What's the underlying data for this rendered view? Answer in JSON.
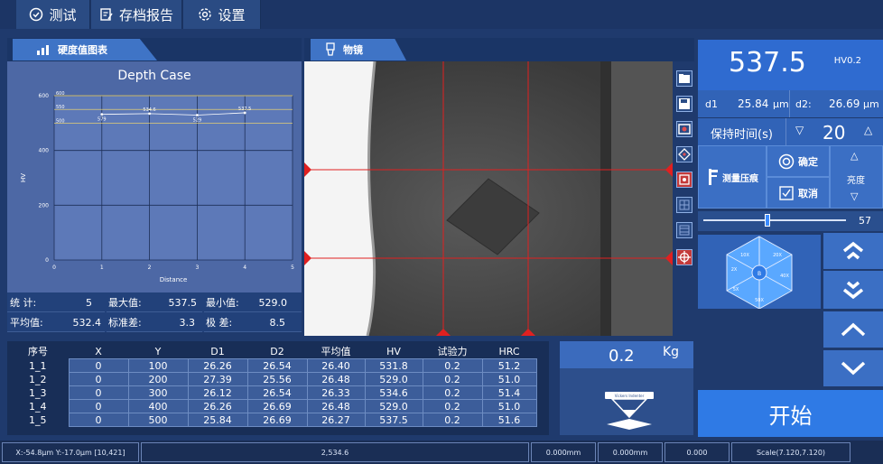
{
  "menu": {
    "test_label": "测试",
    "archive_label": "存档报告",
    "settings_label": "设置"
  },
  "tabs": {
    "chart_tab": "硬度值图表",
    "objective_tab": "物镜"
  },
  "chart_data": {
    "type": "line",
    "title": "Depth Case",
    "xlabel": "Distance",
    "ylabel": "HV",
    "x": [
      1,
      2,
      3,
      4
    ],
    "values": [
      531.8,
      534.6,
      529.0,
      537.5
    ],
    "point_labels": [
      "579",
      "534.6",
      "529",
      "537.5"
    ],
    "xlim": [
      0,
      5
    ],
    "ylim": [
      0,
      600
    ],
    "xticks": [
      "0",
      "1",
      "2",
      "3",
      "4",
      "5"
    ],
    "yticks": [
      "0",
      "200",
      "400",
      "600"
    ],
    "ref_lines": [
      {
        "label": "600",
        "value": 600
      },
      {
        "label": "550",
        "value": 550
      },
      {
        "label": "500",
        "value": 500
      }
    ],
    "grid": true
  },
  "stats": {
    "count_label": "统 计:",
    "count": "5",
    "max_label": "最大值:",
    "max": "537.5",
    "min_label": "最小值:",
    "min": "529.0",
    "avg_label": "平均值:",
    "avg": "532.4",
    "std_label": "标准差:",
    "std": "3.3",
    "range_label": "极 差:",
    "range": "8.5"
  },
  "table": {
    "headers": [
      "序号",
      "X",
      "Y",
      "D1",
      "D2",
      "平均值",
      "HV",
      "试验力",
      "HRC"
    ],
    "rows": [
      [
        "1_1",
        "0",
        "100",
        "26.26",
        "26.54",
        "26.40",
        "531.8",
        "0.2",
        "51.2"
      ],
      [
        "1_2",
        "0",
        "200",
        "27.39",
        "25.56",
        "26.48",
        "529.0",
        "0.2",
        "51.0"
      ],
      [
        "1_3",
        "0",
        "300",
        "26.12",
        "26.54",
        "26.33",
        "534.6",
        "0.2",
        "51.4"
      ],
      [
        "1_4",
        "0",
        "400",
        "26.26",
        "26.69",
        "26.48",
        "529.0",
        "0.2",
        "51.0"
      ],
      [
        "1_5",
        "0",
        "500",
        "25.84",
        "26.69",
        "26.27",
        "537.5",
        "0.2",
        "51.6"
      ]
    ]
  },
  "load": {
    "value": "0.2",
    "unit": "Kg",
    "indenter_label": "Vickers Indenter"
  },
  "right": {
    "hv_value": "537.5",
    "hv_unit": "HV0.2",
    "d1_label": "d1",
    "d1_value": "25.84",
    "d1_unit": "μm",
    "d2_label": "d2:",
    "d2_value": "26.69",
    "d2_unit": "μm",
    "hold_label": "保持时间(s)",
    "hold_value": "20",
    "measure_label": "测量压痕",
    "confirm_label": "确定",
    "cancel_label": "取消",
    "brightness_label": "亮度",
    "brightness_value": "57",
    "brightness_level": 0.45,
    "start_label": "开始",
    "hex_center": "B",
    "hex_labels": [
      "10X",
      "20X",
      "40X",
      "50X",
      "5X",
      "2X"
    ]
  },
  "status": {
    "coords": "X:-54.8μm Y:-17.0μm [10,421]",
    "value_mid": "2,534.6",
    "field1": "0.000mm",
    "field2": "0.000mm",
    "field3": "0.000",
    "scale": "Scale(7.120,7.120)"
  }
}
